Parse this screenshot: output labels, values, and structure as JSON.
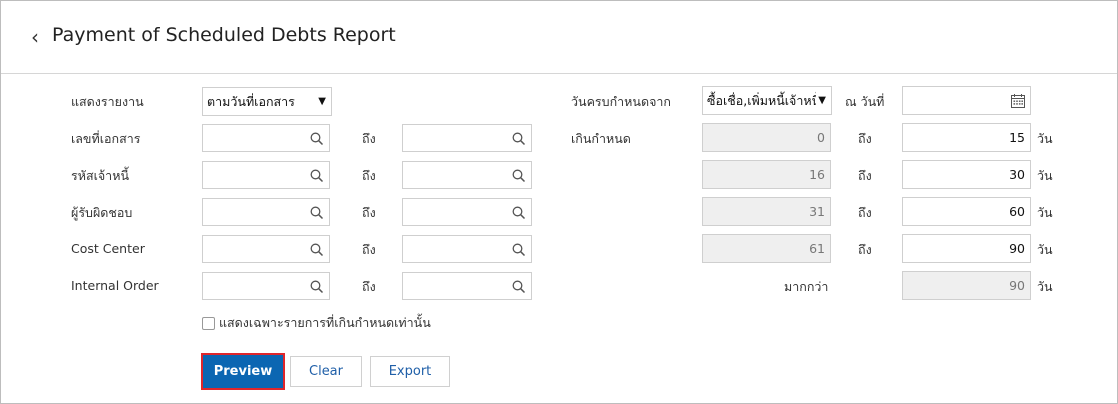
{
  "header": {
    "back_icon": "chevron-left-icon",
    "title": "Payment of Scheduled Debts Report"
  },
  "left": {
    "report_display_label": "แสดงรายงาน",
    "report_display_value": "ตามวันที่เอกสาร",
    "doc_no_label": "เลขที่เอกสาร",
    "creditor_code_label": "รหัสเจ้าหนี้",
    "responsible_label": "ผู้รับผิดชอบ",
    "cost_center_label": "Cost Center",
    "internal_order_label": "Internal Order",
    "to_label": "ถึง"
  },
  "right": {
    "due_from_label": "วันครบกำหนดจาก",
    "due_from_value": "ซื้อเชื่อ,เพิ่มหนี้เจ้าหนี้",
    "as_of_label": "ณ วันที่",
    "as_of_value": "",
    "overdue_label": "เกินกำหนด",
    "to_label": "ถึง",
    "days_label": "วัน",
    "more_than_label": "มากกว่า",
    "ranges": [
      {
        "from": "0",
        "to": "15"
      },
      {
        "from": "16",
        "to": "30"
      },
      {
        "from": "31",
        "to": "60"
      },
      {
        "from": "61",
        "to": "90"
      }
    ],
    "more_than_value": "90"
  },
  "options": {
    "overdue_only_label": "แสดงเฉพาะรายการที่เกินกำหนดเท่านั้น",
    "overdue_only_checked": false
  },
  "actions": {
    "preview": "Preview",
    "clear": "Clear",
    "export": "Export"
  },
  "colors": {
    "primary": "#0b66b2",
    "highlight_border": "#e0262b",
    "link_text": "#1f5fa8",
    "readonly_bg": "#efefef"
  }
}
